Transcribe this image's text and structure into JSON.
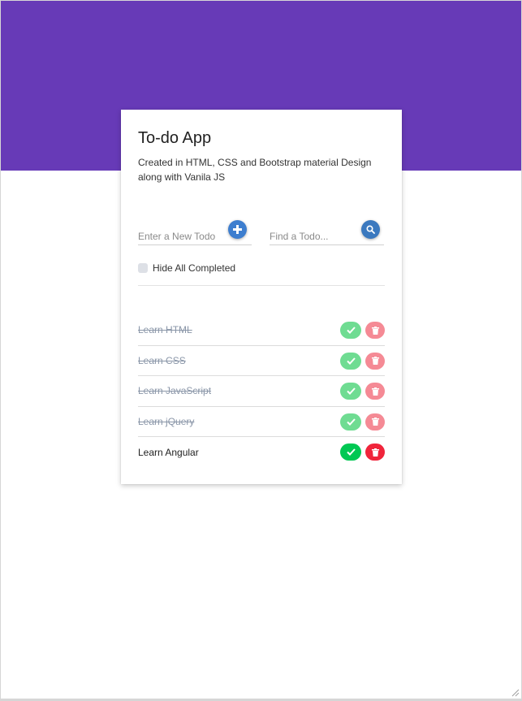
{
  "app": {
    "title": "To-do App",
    "subtitle": "Created in HTML, CSS and Bootstrap material Design along with Vanila JS"
  },
  "new_todo": {
    "placeholder": "Enter a New Todo",
    "value": "",
    "button_icon": "plus-icon"
  },
  "find_todo": {
    "placeholder": "Find a Todo...",
    "value": "",
    "button_icon": "search-icon"
  },
  "filter": {
    "hide_completed_label": "Hide All Completed",
    "checked": false
  },
  "todos": [
    {
      "text": "Learn HTML",
      "completed": true
    },
    {
      "text": "Learn CSS",
      "completed": true
    },
    {
      "text": "Learn JavaScript",
      "completed": true
    },
    {
      "text": "Learn jQuery",
      "completed": true
    },
    {
      "text": "Learn Angular",
      "completed": false
    }
  ],
  "colors": {
    "header": "#673ab7",
    "complete": "#00c853",
    "delete": "#f0253b",
    "action_blue": "#3d7ecf"
  },
  "icons": {
    "complete": "check-icon",
    "delete": "trash-icon"
  }
}
